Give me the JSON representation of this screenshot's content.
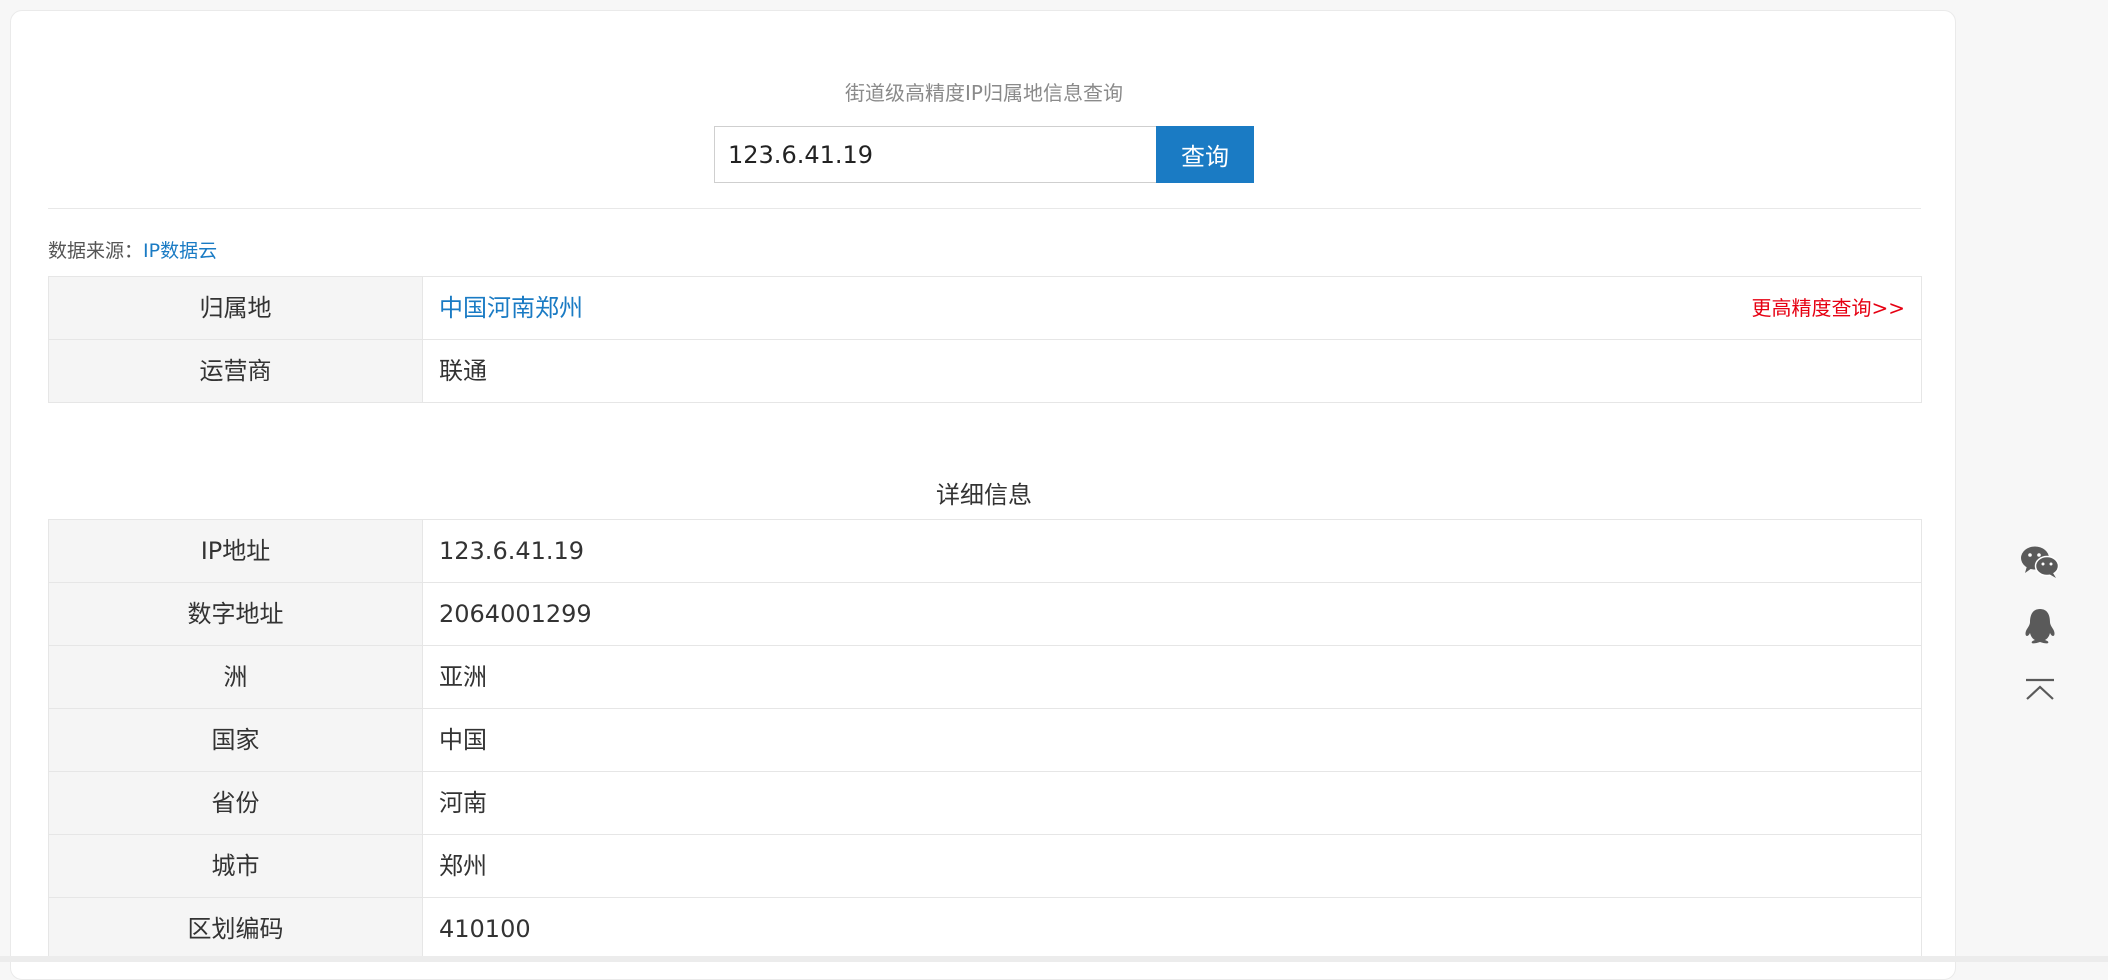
{
  "page": {
    "subtitle": "街道级高精度IP归属地信息查询"
  },
  "search": {
    "value": "123.6.41.19",
    "button_label": "查询"
  },
  "source": {
    "prefix": "数据来源：",
    "link_text": "IP数据云"
  },
  "summary": {
    "rows": [
      {
        "label": "归属地",
        "value": "中国河南郑州",
        "action": "更高精度查询>>"
      },
      {
        "label": "运营商",
        "value": "联通"
      }
    ]
  },
  "details": {
    "title": "详细信息",
    "rows": [
      {
        "label": "IP地址",
        "value": "123.6.41.19"
      },
      {
        "label": "数字地址",
        "value": "2064001299"
      },
      {
        "label": "洲",
        "value": "亚洲"
      },
      {
        "label": "国家",
        "value": "中国"
      },
      {
        "label": "省份",
        "value": "河南"
      },
      {
        "label": "城市",
        "value": "郑州"
      },
      {
        "label": "区划编码",
        "value": "410100"
      }
    ]
  },
  "float_tools": {
    "icons": [
      "wechat-icon",
      "qq-icon",
      "back-to-top-icon"
    ]
  },
  "colors": {
    "accent": "#1a7bc4",
    "highlight": "#e60012",
    "label_bg": "#f5f5f5"
  }
}
